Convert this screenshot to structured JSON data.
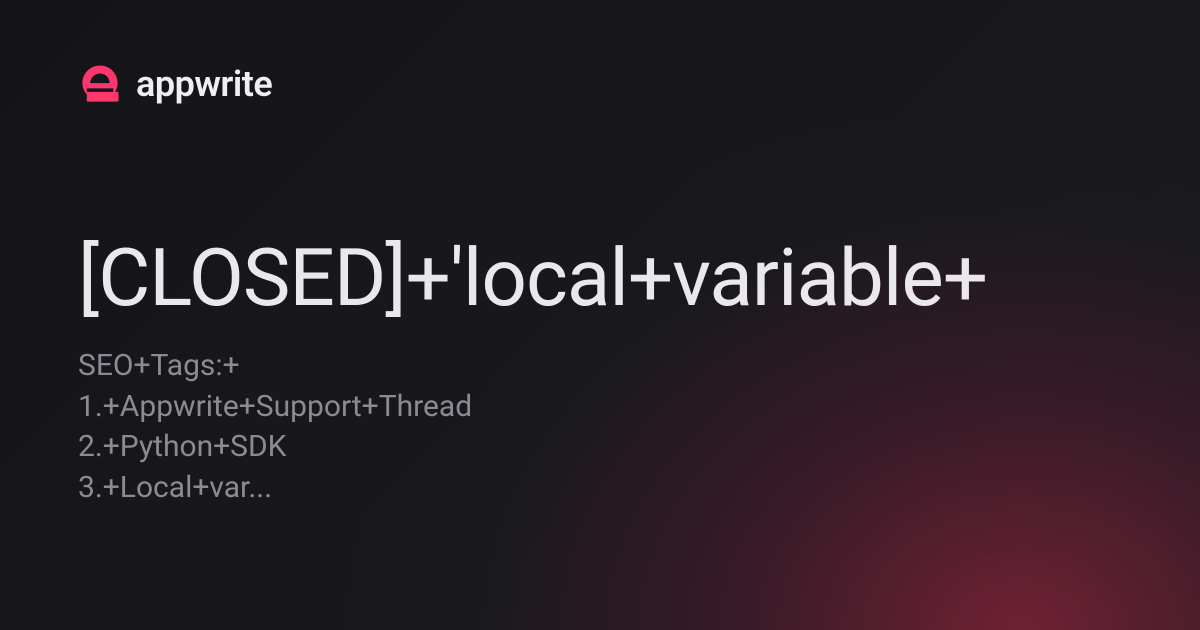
{
  "brand": {
    "name": "appwrite",
    "logo_color": "#fd366e"
  },
  "card": {
    "title": "[CLOSED]+'local+variable+",
    "description": "SEO+Tags:+\n1.+Appwrite+Support+Thread\n2.+Python+SDK\n3.+Local+var..."
  }
}
